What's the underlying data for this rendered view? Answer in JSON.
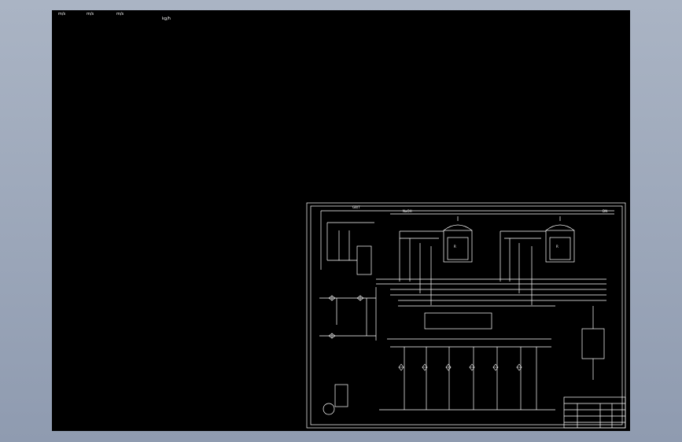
{
  "window": {
    "title": ""
  },
  "viewport": {
    "background": "#000000",
    "line_color": "#ffffff"
  },
  "top_tags": [
    "m/s",
    "m/s",
    "m/s",
    "kg/h"
  ],
  "drawing": {
    "header_labels": [
      "GB/T",
      "NaOH",
      "DN"
    ],
    "equipment_labels": [
      "R",
      "R"
    ],
    "title_block": {
      "rows": [
        "",
        "",
        "",
        ""
      ]
    }
  }
}
